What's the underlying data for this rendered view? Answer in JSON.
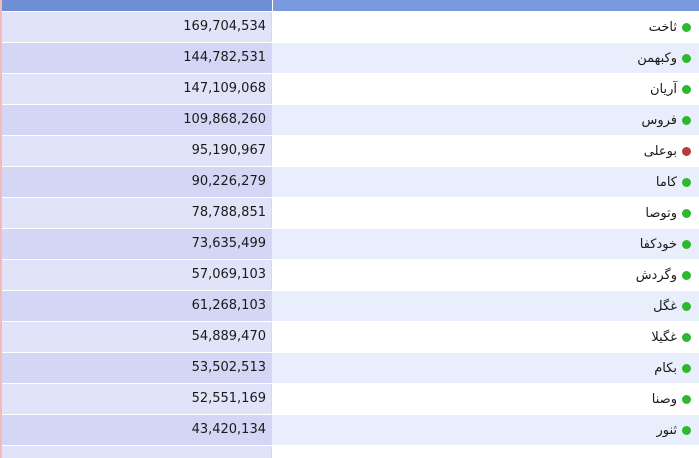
{
  "colors": {
    "up": "#2db82d",
    "down": "#b83a3a"
  },
  "rows": [
    {
      "name": "ثاخت",
      "value": "169,704,534",
      "status": "up"
    },
    {
      "name": "وکبهمن",
      "value": "144,782,531",
      "status": "up"
    },
    {
      "name": "آریان",
      "value": "147,109,068",
      "status": "up"
    },
    {
      "name": "فروس",
      "value": "109,868,260",
      "status": "up"
    },
    {
      "name": "بوعلی",
      "value": "95,190,967",
      "status": "down"
    },
    {
      "name": "کاما",
      "value": "90,226,279",
      "status": "up"
    },
    {
      "name": "وتوصا",
      "value": "78,788,851",
      "status": "up"
    },
    {
      "name": "خودکفا",
      "value": "73,635,499",
      "status": "up"
    },
    {
      "name": "وگردش",
      "value": "57,069,103",
      "status": "up"
    },
    {
      "name": "غگل",
      "value": "61,268,103",
      "status": "up"
    },
    {
      "name": "غگیلا",
      "value": "54,889,470",
      "status": "up"
    },
    {
      "name": "بکام",
      "value": "53,502,513",
      "status": "up"
    },
    {
      "name": "وصنا",
      "value": "52,551,169",
      "status": "up"
    },
    {
      "name": "ثنور",
      "value": "43,420,134",
      "status": "up"
    },
    {
      "name": "",
      "value": "",
      "status": "up"
    }
  ]
}
